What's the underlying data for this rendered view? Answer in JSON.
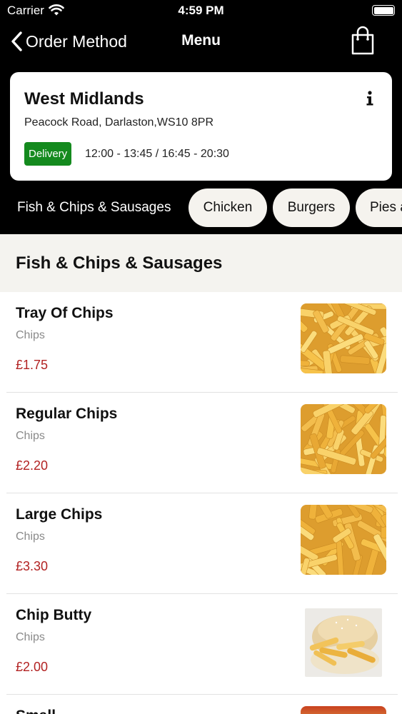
{
  "status_bar": {
    "carrier": "Carrier",
    "time": "4:59 PM"
  },
  "nav": {
    "back_label": "Order Method",
    "title": "Menu",
    "cart_icon": "shopping-bag-icon"
  },
  "store": {
    "region": "West Midlands",
    "address": "Peacock Road, Darlaston,WS10 8PR",
    "badge": "Delivery",
    "hours": "12:00 - 13:45 / 16:45 - 20:30",
    "info_icon": "info-icon"
  },
  "categories": [
    {
      "label": "Fish & Chips & Sausages",
      "active": true
    },
    {
      "label": "Chicken",
      "active": false
    },
    {
      "label": "Burgers",
      "active": false
    },
    {
      "label": "Pies a",
      "active": false
    }
  ],
  "section": {
    "title": "Fish & Chips & Sausages"
  },
  "items": [
    {
      "name": "Tray Of Chips",
      "category": "Chips",
      "price": "£1.75",
      "image": "chips-photo"
    },
    {
      "name": "Regular Chips",
      "category": "Chips",
      "price": "£2.20",
      "image": "chips-photo"
    },
    {
      "name": "Large Chips",
      "category": "Chips",
      "price": "£3.30",
      "image": "chips-photo"
    },
    {
      "name": "Chip Butty",
      "category": "Chips",
      "price": "£2.00",
      "image": "chip-butty-photo"
    },
    {
      "name": "Small",
      "category": "",
      "price": "",
      "image": "food-photo"
    }
  ],
  "colors": {
    "accent": "#148a1e",
    "price": "#b22222",
    "section_bg": "#f4f3ef",
    "pill_bg": "#f5f3ee"
  }
}
